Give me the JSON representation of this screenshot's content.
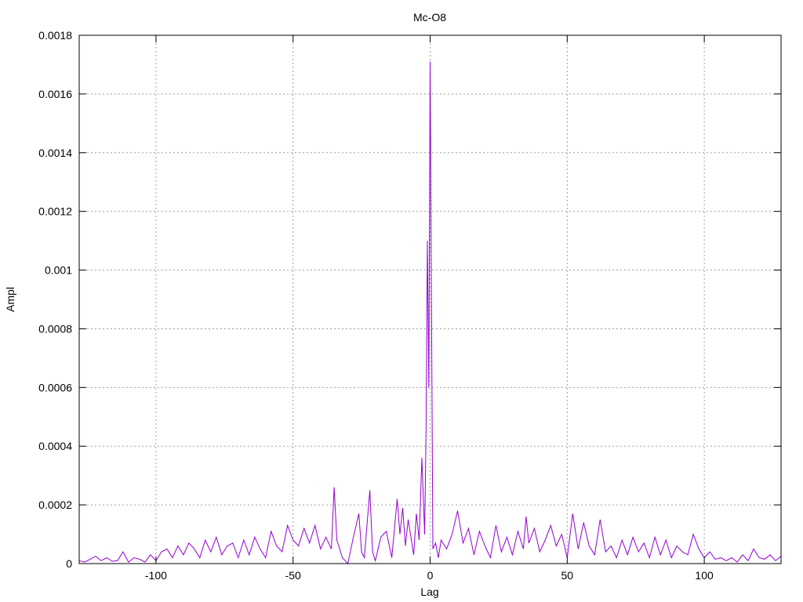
{
  "chart_data": {
    "type": "line",
    "title": "Mc-O8",
    "xlabel": "Lag",
    "ylabel": "Ampl",
    "xlim": [
      -128,
      128
    ],
    "ylim": [
      0,
      0.0018
    ],
    "grid": true,
    "legend": "none",
    "x_ticks": [
      -100,
      -50,
      0,
      50,
      100
    ],
    "x_tick_labels": [
      "-100",
      "-50",
      "0",
      "50",
      "100"
    ],
    "y_ticks": [
      0,
      0.0002,
      0.0004,
      0.0006,
      0.0008,
      0.001,
      0.0012,
      0.0014,
      0.0016,
      0.0018
    ],
    "y_tick_labels": [
      "0",
      "0.0002",
      "0.0004",
      "0.0006",
      "0.0008",
      "0.001",
      "0.0012",
      "0.0014",
      "0.0016",
      "0.0018"
    ],
    "series": [
      {
        "color": "#9400d3",
        "x": [
          -128,
          -126,
          -124,
          -122,
          -120,
          -118,
          -116,
          -114,
          -112,
          -110,
          -108,
          -106,
          -104,
          -102,
          -100,
          -98,
          -96,
          -94,
          -92,
          -90,
          -88,
          -86,
          -84,
          -82,
          -80,
          -78,
          -76,
          -74,
          -72,
          -70,
          -68,
          -66,
          -64,
          -62,
          -60,
          -58,
          -56,
          -54,
          -52,
          -50,
          -48,
          -46,
          -44,
          -42,
          -40,
          -38,
          -36,
          -35,
          -34,
          -32,
          -30,
          -28,
          -26,
          -25,
          -24,
          -22,
          -21,
          -20,
          -18,
          -16,
          -14,
          -12,
          -11,
          -10,
          -9,
          -8,
          -6,
          -5,
          -4,
          -3,
          -2,
          -1.5,
          -1,
          -0.5,
          0,
          0.5,
          1,
          2,
          3,
          4,
          6,
          8,
          10,
          12,
          14,
          16,
          18,
          20,
          22,
          24,
          26,
          28,
          30,
          32,
          34,
          35,
          36,
          38,
          40,
          42,
          44,
          46,
          48,
          50,
          52,
          54,
          56,
          58,
          60,
          62,
          64,
          66,
          68,
          70,
          72,
          74,
          76,
          78,
          80,
          82,
          84,
          86,
          88,
          90,
          92,
          94,
          96,
          98,
          100,
          102,
          104,
          106,
          108,
          110,
          112,
          114,
          116,
          118,
          120,
          122,
          124,
          126,
          128
        ],
        "y": [
          1e-05,
          5e-06,
          1.5e-05,
          2.5e-05,
          1e-05,
          2e-05,
          8e-06,
          1e-05,
          4e-05,
          5e-06,
          2e-05,
          1.5e-05,
          5e-06,
          3e-05,
          1e-05,
          4e-05,
          5e-05,
          2e-05,
          6e-05,
          3e-05,
          7e-05,
          5e-05,
          2e-05,
          8e-05,
          4e-05,
          9e-05,
          3e-05,
          6e-05,
          7e-05,
          2e-05,
          8e-05,
          3e-05,
          9e-05,
          5e-05,
          2e-05,
          0.00011,
          6e-05,
          4e-05,
          0.00013,
          8e-05,
          6e-05,
          0.00012,
          7e-05,
          0.00013,
          5e-05,
          9e-05,
          5e-05,
          0.00026,
          8e-05,
          2e-05,
          0.0,
          9e-05,
          0.00017,
          4e-05,
          2e-05,
          0.00025,
          4e-05,
          1e-05,
          9e-05,
          0.00011,
          2e-05,
          0.00022,
          0.0001,
          0.00019,
          6e-05,
          0.00015,
          3e-05,
          0.00017,
          8e-05,
          0.00036,
          0.0001,
          0.00045,
          0.0011,
          0.0006,
          0.00171,
          0.0009,
          5e-05,
          7e-05,
          2e-05,
          8e-05,
          5e-05,
          0.0001,
          0.00018,
          7e-05,
          0.00012,
          3e-05,
          0.00011,
          6e-05,
          2e-05,
          0.00013,
          4e-05,
          9e-05,
          3e-05,
          0.00011,
          5e-05,
          0.00016,
          7e-05,
          0.00012,
          4e-05,
          8e-05,
          0.00013,
          6e-05,
          0.0001,
          2e-05,
          0.00017,
          5e-05,
          0.00014,
          6e-05,
          3e-05,
          0.00015,
          4e-05,
          6e-05,
          2e-05,
          8e-05,
          3e-05,
          9e-05,
          4e-05,
          7e-05,
          2e-05,
          9e-05,
          3e-05,
          8e-05,
          2e-05,
          6e-05,
          4e-05,
          3e-05,
          0.0001,
          5e-05,
          2e-05,
          4e-05,
          1.5e-05,
          2e-05,
          1e-05,
          2e-05,
          5e-06,
          3e-05,
          1e-05,
          5e-05,
          2e-05,
          1.5e-05,
          3e-05,
          1e-05,
          2.5e-05
        ]
      }
    ]
  }
}
